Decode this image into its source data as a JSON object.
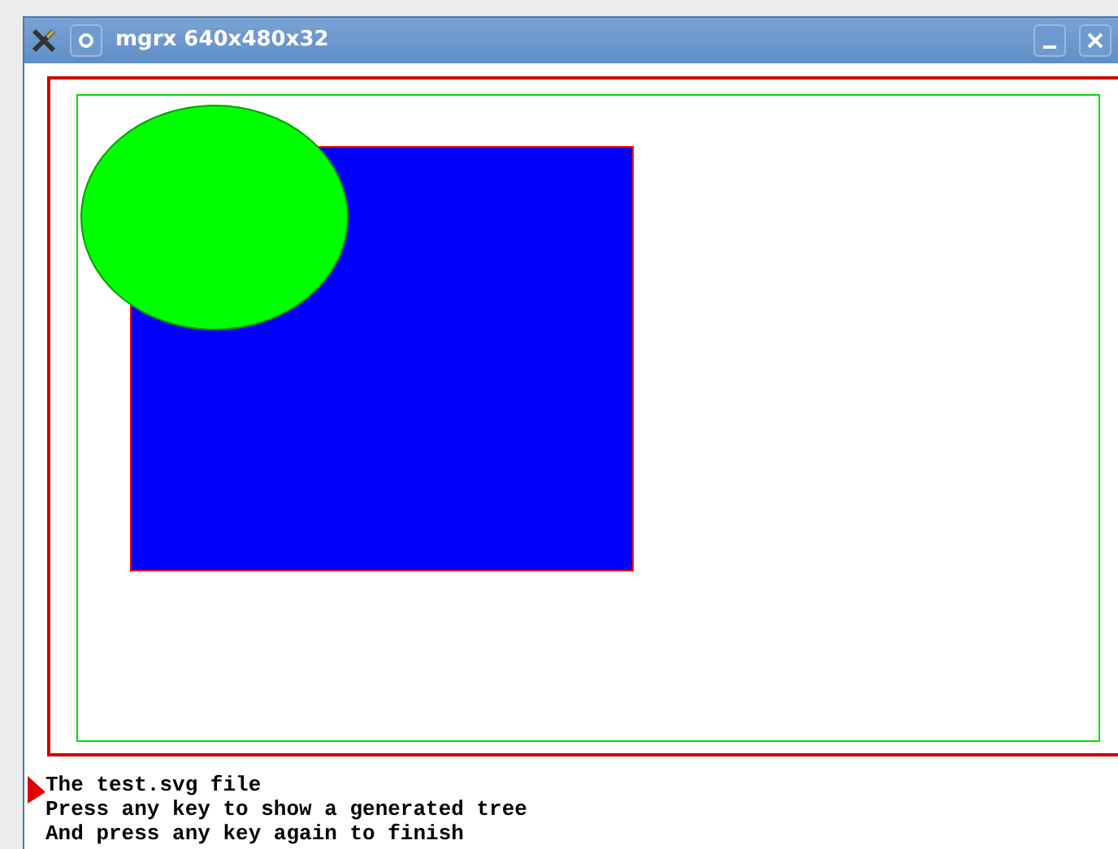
{
  "window": {
    "title": "mgrx 640x480x32"
  },
  "console_lines": [
    "The test.svg file",
    "Press any key to show a generated tree",
    "And press any key again to finish"
  ]
}
